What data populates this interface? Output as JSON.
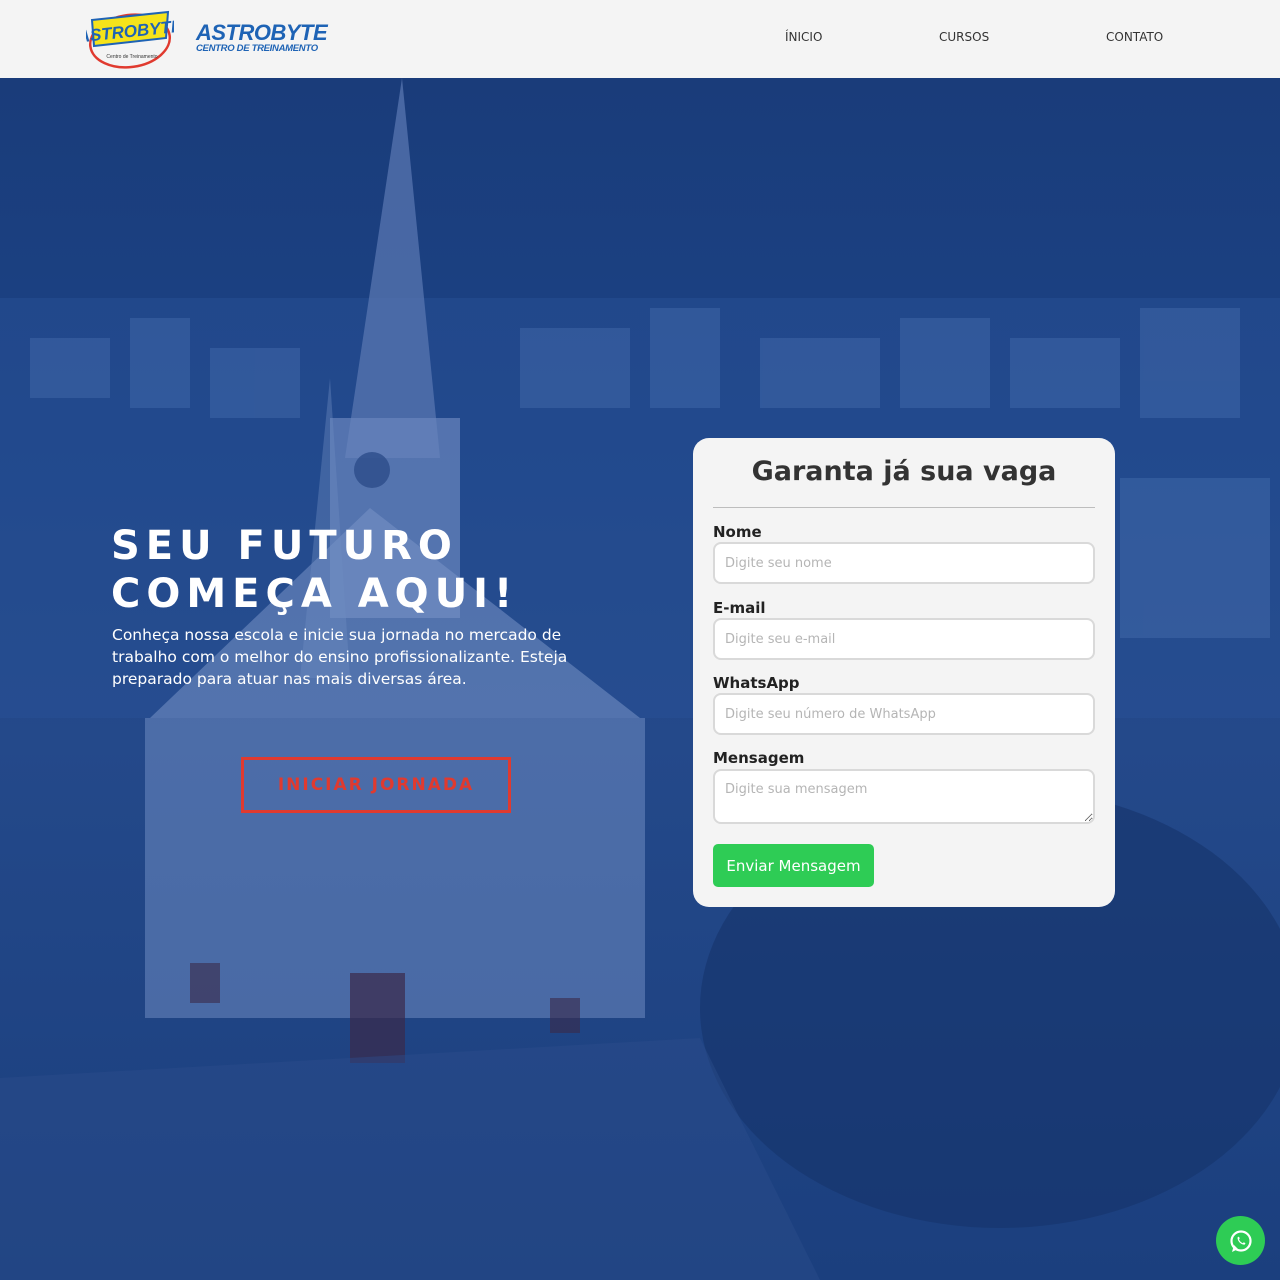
{
  "header": {
    "logo_badge_text": "ASTROBYTE",
    "logo_badge_sub": "Centro de Treinamento",
    "logo_title": "ASTROBYTE",
    "logo_subtitle": "CENTRO DE TREINAMENTO",
    "nav": [
      {
        "label": "ÍNICIO"
      },
      {
        "label": "CURSOS"
      },
      {
        "label": "CONTATO"
      }
    ]
  },
  "hero": {
    "headline": "SEU FUTURO COMEÇA AQUI!",
    "lead": "Conheça nossa escola e inicie sua jornada no mercado de trabalho com o melhor do ensino profissionalizante. Esteja preparado para atuar nas mais diversas área.",
    "cta_label": "INICIAR JORNADA"
  },
  "form": {
    "title": "Garanta já sua vaga",
    "fields": [
      {
        "label": "Nome",
        "placeholder": "Digite seu nome",
        "value": ""
      },
      {
        "label": "E-mail",
        "placeholder": "Digite seu e-mail",
        "value": ""
      },
      {
        "label": "WhatsApp",
        "placeholder": "Digite seu número de WhatsApp",
        "value": ""
      },
      {
        "label": "Mensagem",
        "placeholder": "Digite sua mensagem",
        "value": ""
      }
    ],
    "submit_label": "Enviar Mensagem"
  },
  "colors": {
    "hero_overlay": "#1e3f7d",
    "cta_red": "#e03a2f",
    "submit_green": "#2ecc55",
    "logo_blue": "#1e63b5",
    "logo_yellow": "#f5e31a"
  },
  "icons": {
    "whatsapp": "whatsapp-icon"
  }
}
